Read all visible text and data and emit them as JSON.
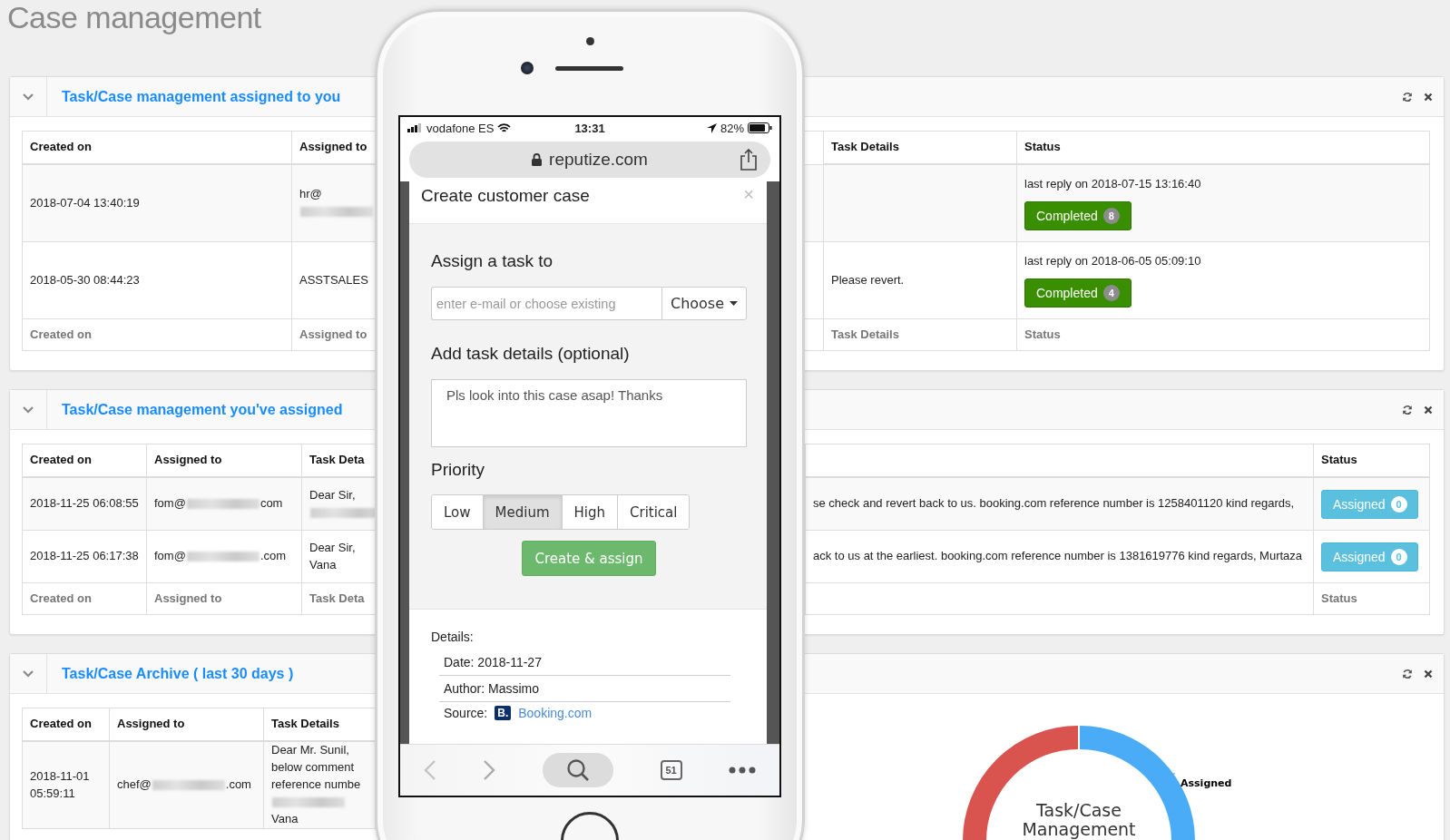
{
  "page_title": "Case management",
  "panels": [
    {
      "title": "Task/Case management assigned to you",
      "columns": [
        {
          "kind": "label",
          "label": "Created on"
        },
        {
          "kind": "label",
          "label": "Assigned to"
        },
        {
          "kind": "label",
          "label": "Task Details"
        },
        {
          "kind": "label",
          "label": "Status"
        }
      ],
      "rows": [
        [
          {
            "kind": "text",
            "text": "2018-07-04 13:40:19"
          },
          {
            "kind": "mixed",
            "parts": [
              {
                "kind": "text",
                "text": "hr@"
              },
              {
                "kind": "blur"
              }
            ]
          },
          {
            "kind": "empty"
          },
          {
            "kind": "status",
            "note": "last reply on 2018-07-15 13:16:40",
            "badge": {
              "kind": "completed",
              "label": "Completed",
              "count": "8"
            }
          }
        ],
        [
          {
            "kind": "text",
            "text": "2018-05-30 08:44:23"
          },
          {
            "kind": "text",
            "text": "ASSTSALES"
          },
          {
            "kind": "text",
            "text": "Please revert."
          },
          {
            "kind": "status",
            "note": "last reply on 2018-06-05 05:09:10",
            "badge": {
              "kind": "completed",
              "label": "Completed",
              "count": "4"
            }
          }
        ]
      ],
      "footer": [
        {
          "kind": "label",
          "label": "Created on"
        },
        {
          "kind": "label",
          "label": "Assigned to"
        },
        {
          "kind": "label",
          "label": "Task Details"
        },
        {
          "kind": "label",
          "label": "Status"
        }
      ]
    },
    {
      "title": "Task/Case management you've assigned",
      "columns": [
        {
          "kind": "label",
          "label": "Created on"
        },
        {
          "kind": "label",
          "label": "Assigned to"
        },
        {
          "kind": "label",
          "label": "Task Deta"
        },
        {
          "kind": "blank"
        },
        {
          "kind": "label",
          "label": "Status"
        }
      ],
      "rows": [
        [
          {
            "kind": "text",
            "text": "2018-11-25 06:08:55"
          },
          {
            "kind": "mixed",
            "parts": [
              {
                "kind": "text",
                "text": "fom@"
              },
              {
                "kind": "blur"
              },
              {
                "kind": "text",
                "text": "com"
              }
            ]
          },
          {
            "kind": "mixed",
            "parts": [
              {
                "kind": "text",
                "text": "Dear Sir,"
              },
              {
                "kind": "blur"
              }
            ]
          },
          {
            "kind": "text",
            "text": "se check and revert back to us. booking.com reference number is 1258401120 kind regards,"
          },
          {
            "kind": "status",
            "badge": {
              "kind": "assigned",
              "label": "Assigned",
              "count": "0"
            }
          }
        ],
        [
          {
            "kind": "text",
            "text": "2018-11-25 06:17:38"
          },
          {
            "kind": "mixed",
            "parts": [
              {
                "kind": "text",
                "text": "fom@"
              },
              {
                "kind": "blur"
              },
              {
                "kind": "text",
                "text": ".com"
              }
            ]
          },
          {
            "kind": "text",
            "text": "Dear Sir, Vana"
          },
          {
            "kind": "text",
            "text": "ack to us at the earliest. booking.com reference number is 1381619776 kind regards, Murtaza"
          },
          {
            "kind": "status",
            "badge": {
              "kind": "assigned",
              "label": "Assigned",
              "count": "0"
            }
          }
        ]
      ],
      "footer": [
        {
          "kind": "label",
          "label": "Created on"
        },
        {
          "kind": "label",
          "label": "Assigned to"
        },
        {
          "kind": "label",
          "label": "Task Deta"
        },
        {
          "kind": "blank"
        },
        {
          "kind": "label",
          "label": "Status"
        }
      ]
    },
    {
      "title": "Task/Case Archive ( last 30 days )",
      "columns": [
        {
          "kind": "label",
          "label": "Created on"
        },
        {
          "kind": "label",
          "label": "Assigned to"
        },
        {
          "kind": "label",
          "label": "Task Details"
        }
      ],
      "rows": [
        [
          {
            "kind": "text",
            "text": "2018-11-01 05:59:11"
          },
          {
            "kind": "mixed",
            "parts": [
              {
                "kind": "text",
                "text": "chef@"
              },
              {
                "kind": "blur"
              },
              {
                "kind": "text",
                "text": ".com"
              }
            ]
          },
          {
            "kind": "mixed",
            "parts": [
              {
                "kind": "text",
                "text": "Dear Mr. Sunil, below comment reference numbe"
              },
              {
                "kind": "blur"
              },
              {
                "kind": "text",
                "text": "Vana"
              }
            ]
          }
        ]
      ],
      "donut": {
        "center_text": "Task/Case Management",
        "label": "Assigned"
      }
    }
  ],
  "phone": {
    "carrier": "vodafone ES",
    "time": "13:31",
    "battery": "82%",
    "url": "reputize.com",
    "modal": {
      "title": "Create customer case",
      "close": "×",
      "assign_label": "Assign a task to",
      "assignee": {
        "placeholder": "enter e-mail or choose existing"
      },
      "choose_button": "Choose",
      "details_label": "Add task details (optional)",
      "details": {
        "value": "Pls look into this case asap! Thanks"
      },
      "priority_label": "Priority",
      "priority_options": [
        {
          "label": "Low",
          "selected": false
        },
        {
          "label": "Medium",
          "selected": true
        },
        {
          "label": "High",
          "selected": false
        },
        {
          "label": "Critical",
          "selected": false
        }
      ],
      "submit": "Create & assign",
      "info_title": "Details:",
      "info": [
        {
          "kind": "text",
          "text": "Date: 2018-11-27"
        },
        {
          "kind": "text",
          "text": "Author: Massimo"
        },
        {
          "kind": "source",
          "label": "Source:",
          "logo": "B.",
          "link": "Booking.com"
        }
      ]
    },
    "toolbar": {
      "tab_count": "51"
    }
  }
}
